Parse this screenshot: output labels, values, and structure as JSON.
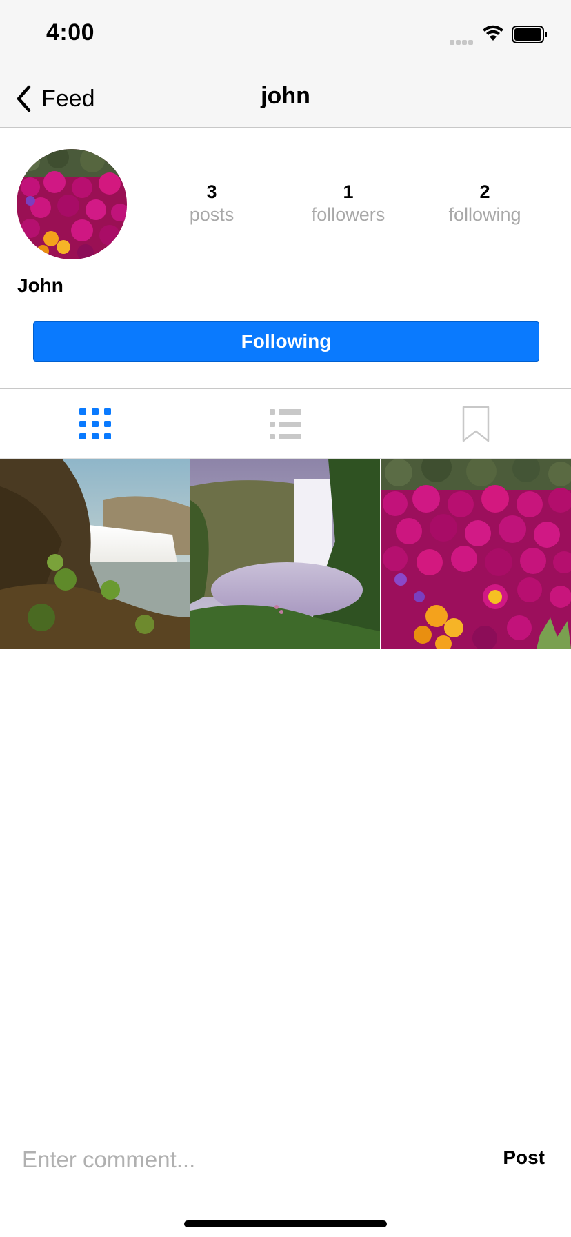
{
  "status_bar": {
    "time": "4:00",
    "icons": [
      "signal-icon",
      "wifi-icon",
      "battery-icon"
    ]
  },
  "nav": {
    "back_label": "Feed",
    "title": "john",
    "back_icon": "chevron-left-icon"
  },
  "profile": {
    "name": "John",
    "avatar_icon": "avatar",
    "stats": [
      {
        "count": "3",
        "label": "posts"
      },
      {
        "count": "1",
        "label": "followers"
      },
      {
        "count": "2",
        "label": "following"
      }
    ],
    "follow_button_label": "Following"
  },
  "tabs": [
    {
      "icon": "grid-icon",
      "active": true
    },
    {
      "icon": "list-icon",
      "active": false
    },
    {
      "icon": "bookmark-icon",
      "active": false
    }
  ],
  "posts": [
    {
      "subject": "waterfall-rocks-photo"
    },
    {
      "subject": "waterfall-canyon-photo"
    },
    {
      "subject": "pink-flowers-photo"
    }
  ],
  "comment": {
    "placeholder": "Enter comment...",
    "post_label": "Post"
  },
  "colors": {
    "accent": "#0a7afe",
    "inactive": "#c8c8c8",
    "muted_text": "#a8a8a8"
  }
}
